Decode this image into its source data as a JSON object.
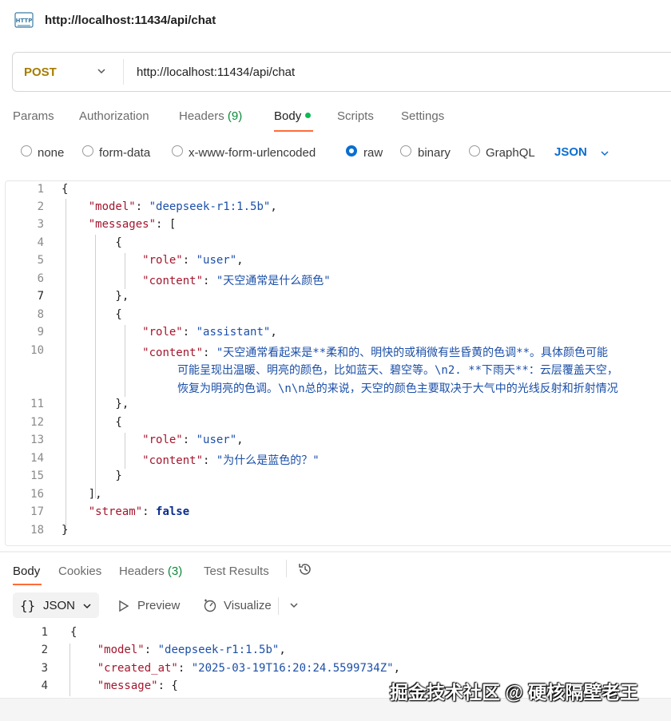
{
  "request": {
    "title": "http://localhost:11434/api/chat",
    "method": "POST",
    "url": "http://localhost:11434/api/chat"
  },
  "request_tabs": [
    {
      "label": "Params"
    },
    {
      "label": "Authorization"
    },
    {
      "label": "Headers",
      "count": "(9)"
    },
    {
      "label": "Body"
    },
    {
      "label": "Scripts"
    },
    {
      "label": "Settings"
    }
  ],
  "body_types": [
    "none",
    "form-data",
    "x-www-form-urlencoded",
    "raw",
    "binary",
    "GraphQL"
  ],
  "selected_body_type": "raw",
  "format": "JSON",
  "editor": {
    "current_line": 7,
    "line_numbers": [
      "1",
      "2",
      "3",
      "4",
      "5",
      "6",
      "7",
      "8",
      "9",
      "10",
      "",
      "",
      "11",
      "12",
      "13",
      "14",
      "15",
      "16",
      "17",
      "18"
    ]
  },
  "request_body": {
    "model_key": "\"model\"",
    "model_value": "\"deepseek-r1:1.5b\"",
    "messages_key": "\"messages\"",
    "role_key": "\"role\"",
    "content_key": "\"content\"",
    "user_role": "\"user\"",
    "assistant_role": "\"assistant\"",
    "content_1": "\"天空通常是什么颜色\"",
    "content_2_line1": "\"天空通常看起来是**柔和的、明快的或稍微有些昏黄的色调**。具体颜色可能",
    "content_2_line2": "可能呈现出温暖、明亮的颜色，比如蓝天、碧空等。\\n2. **下雨天**：云层覆盖天空，",
    "content_2_line3": "恢复为明亮的色调。\\n\\n总的来说，天空的颜色主要取决于大气中的光线反射和折射情况",
    "content_3": "\"为什么是蓝色的？\"",
    "stream_key": "\"stream\"",
    "stream_value": "false"
  },
  "response_tabs": [
    {
      "label": "Body"
    },
    {
      "label": "Cookies"
    },
    {
      "label": "Headers",
      "count": "(3)"
    },
    {
      "label": "Test Results"
    }
  ],
  "response_toolbar": {
    "format": "JSON",
    "preview": "Preview",
    "visualize": "Visualize"
  },
  "response_body": {
    "line_numbers": [
      "1",
      "2",
      "3",
      "4"
    ],
    "model_key": "\"model\"",
    "model_value": "\"deepseek-r1:1.5b\"",
    "created_at_key": "\"created_at\"",
    "created_at_value": "\"2025-03-19T16:20:24.5599734Z\"",
    "message_key": "\"message\""
  },
  "watermark": "掘金技术社区 @ 硬核隔壁老王",
  "colors": {
    "accent": "#ff6c37",
    "method": "#a67c00",
    "link_blue": "#0b6ed0",
    "json_key": "#a3162d",
    "json_string": "#1b4fa8"
  }
}
